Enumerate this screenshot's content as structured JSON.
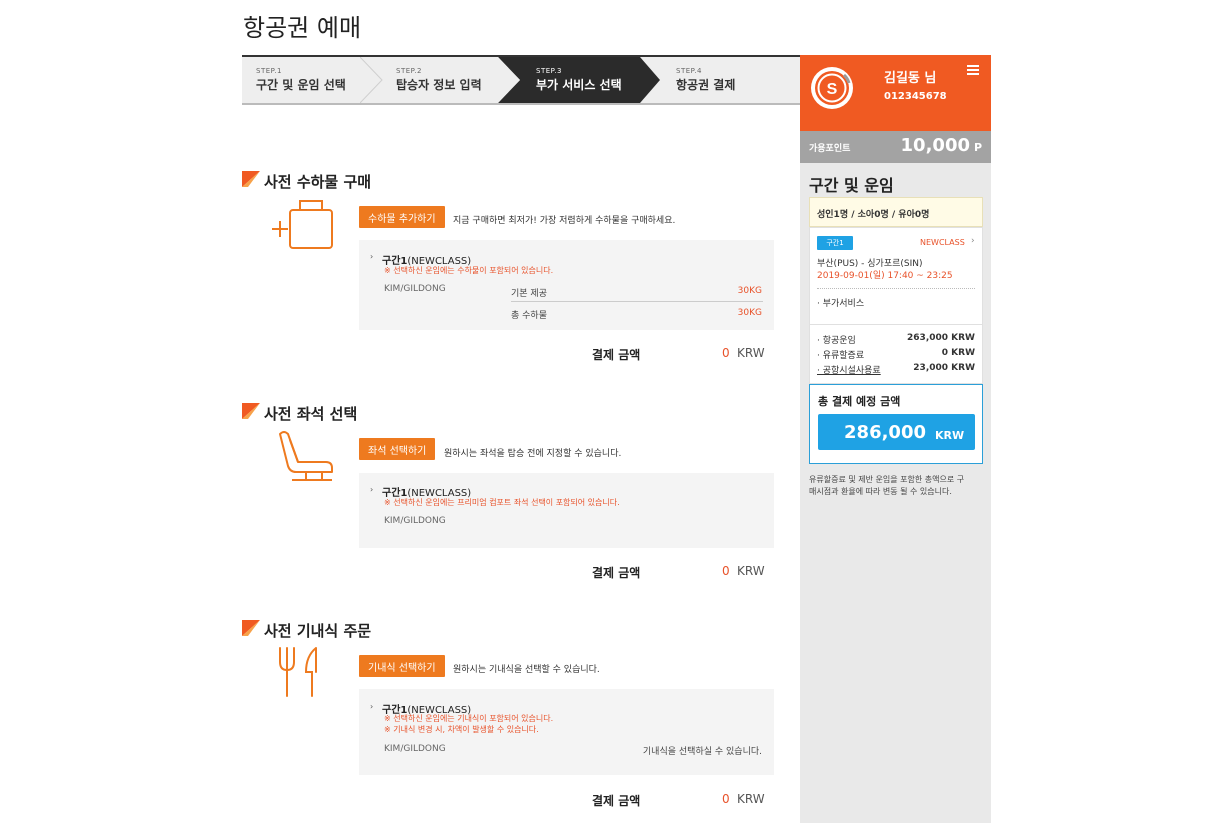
{
  "page_title": "항공권 예매",
  "steps": [
    {
      "no": "STEP.1",
      "label": "구간 및 운임 선택"
    },
    {
      "no": "STEP.2",
      "label": "탑승자 정보 입력"
    },
    {
      "no": "STEP.3",
      "label": "부가 서비스 선택"
    },
    {
      "no": "STEP.4",
      "label": "항공권 결제"
    }
  ],
  "baggage": {
    "title": "사전 수하물 구매",
    "button": "수하물 추가하기",
    "desc": "지금 구매하면 최저가! 가장 저렴하게 수하물을 구매하세요.",
    "segment": "구간1",
    "segment_class": "(NEWCLASS)",
    "note": "※ 선택하신 운임에는 수하물이 포함되어 있습니다.",
    "passenger": "KIM/GILDONG",
    "rows": [
      {
        "label": "기본 제공",
        "value": "30KG"
      },
      {
        "label": "총 수하물",
        "value": "30KG"
      }
    ],
    "pay_label": "결제 금액",
    "pay_amount": "0",
    "pay_currency": "KRW"
  },
  "seat": {
    "title": "사전 좌석 선택",
    "button": "좌석 선택하기",
    "desc": "원하시는 좌석을 탑승 전에 지정할 수 있습니다.",
    "segment": "구간1",
    "segment_class": "(NEWCLASS)",
    "note": "※ 선택하신 운임에는 프리미엄 컴포트 좌석 선택이 포함되어 있습니다.",
    "passenger": "KIM/GILDONG",
    "pay_label": "결제 금액",
    "pay_amount": "0",
    "pay_currency": "KRW"
  },
  "meal": {
    "title": "사전 기내식 주문",
    "button": "기내식 선택하기",
    "desc": "원하시는 기내식을 선택할 수 있습니다.",
    "segment": "구간1",
    "segment_class": "(NEWCLASS)",
    "note1": "※ 선택하신 운임에는 기내식이 포함되어 있습니다.",
    "note2": "※ 기내식 변경 시, 차액이 발생할 수 있습니다.",
    "passenger": "KIM/GILDONG",
    "meal_status": "기내식을 선택하실 수 있습니다.",
    "pay_label": "결제 금액",
    "pay_amount": "0",
    "pay_currency": "KRW"
  },
  "sidebar": {
    "user_name": "김길동 님",
    "user_id": "012345678",
    "points_label": "가용포인트",
    "points_value": "10,000",
    "points_unit": "P",
    "section_title": "구간 및 운임",
    "pax_summary": "성인1명 / 소아0명 / 유아0명",
    "segment_badge": "구간1",
    "fare_class": "NEWCLASS",
    "route": "부산(PUS) - 싱가포르(SIN)",
    "datetime": "2019-09-01(일) 17:40 ~ 23:25",
    "extra_service": "· 부가서비스",
    "fares": [
      {
        "label": "· 항공운임",
        "value": "263,000 KRW"
      },
      {
        "label": "· 유류할증료",
        "value": "0 KRW"
      },
      {
        "label": "· 공항시설사용료",
        "value": "23,000 KRW"
      }
    ],
    "total_label": "총 결제 예정 금액",
    "total_amount": "286,000",
    "total_currency": "KRW",
    "disclaimer_line1": "유류할증료 및 제반 운임을 포함한 총액으로 구",
    "disclaimer_line2": "매시점과 환율에 따라 변동 될 수 있습니다."
  },
  "colors": {
    "accent_orange": "#ee7a1f",
    "header_orange": "#f05a22",
    "note_red": "#e8522a",
    "total_blue": "#1fa2e4"
  }
}
